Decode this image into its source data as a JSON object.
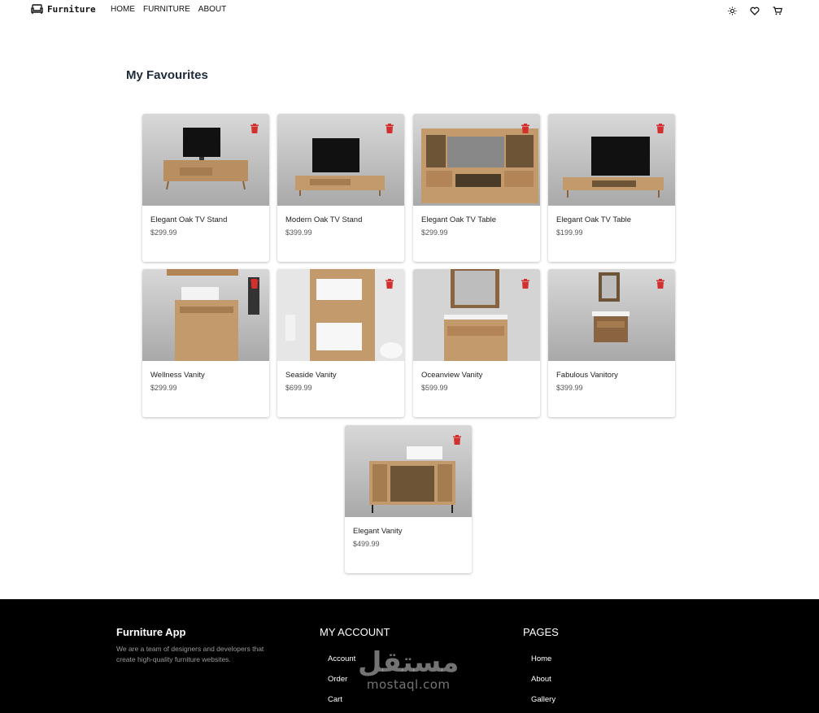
{
  "header": {
    "brand": "Furniture",
    "nav": [
      "HOME",
      "FURNITURE",
      "ABOUT"
    ],
    "icons": [
      "sun-icon",
      "heart-icon",
      "cart-icon"
    ]
  },
  "page": {
    "title": "My Favourites"
  },
  "products": [
    {
      "name": "Elegant Oak TV Stand",
      "price": "$299.99"
    },
    {
      "name": "Modern Oak TV Stand",
      "price": "$399.99"
    },
    {
      "name": "Elegant Oak TV Table",
      "price": "$299.99"
    },
    {
      "name": "Elegant Oak TV Table",
      "price": "$199.99"
    },
    {
      "name": "Wellness Vanity",
      "price": "$299.99"
    },
    {
      "name": "Seaside Vanity",
      "price": "$699.99"
    },
    {
      "name": "Oceanview Vanity",
      "price": "$599.99"
    },
    {
      "name": "Fabulous Vanitory",
      "price": "$399.99"
    },
    {
      "name": "Elegant Vanity",
      "price": "$499.99"
    }
  ],
  "footer": {
    "about_title": "Furniture App",
    "about_text": "We are a team of designers and developers that create high-quality furniture websites.",
    "account_title": "MY ACCOUNT",
    "account_links": [
      "Account",
      "Order",
      "Cart"
    ],
    "pages_title": "PAGES",
    "pages_links": [
      "Home",
      "About",
      "Gallery"
    ],
    "watermark_ar": "مستقل",
    "watermark_lat": "mostaql.com"
  },
  "colors": {
    "trash": "#d32f2f",
    "footer_bg": "#000000",
    "title": "#1d2b3a"
  }
}
